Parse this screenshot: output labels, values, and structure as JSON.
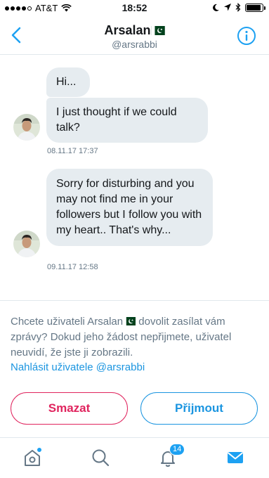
{
  "status_bar": {
    "carrier": "AT&T",
    "time": "18:52",
    "battery_level": 0.9
  },
  "header": {
    "name": "Arsalan",
    "handle": "@arsrabbi",
    "back_icon": "chevron-left-icon",
    "info_icon": "info-icon"
  },
  "messages": [
    {
      "text": "Hi...",
      "timestamp": ""
    },
    {
      "text": "I just thought if we could talk?",
      "timestamp": "08.11.17 17:37"
    },
    {
      "text": "Sorry for disturbing and you may not find me in your followers but I follow you with my heart.. That's why...",
      "timestamp": "09.11.17 12:58"
    }
  ],
  "request": {
    "text_prefix": "Chcete uživateli Arsalan",
    "text_suffix": " dovolit zasílat vám zprávy? Dokud jeho žádost nepřijmete, uživatel neuvidí, že jste ji zobrazili.",
    "report_link": "Nahlásit uživatele @arsrabbi",
    "delete_label": "Smazat",
    "accept_label": "Přijmout"
  },
  "tabs": {
    "home_icon": "home-icon",
    "search_icon": "search-icon",
    "notifications_icon": "bell-icon",
    "notifications_badge": "14",
    "messages_icon": "mail-icon"
  },
  "colors": {
    "accent": "#1da1f2",
    "danger": "#e0245e",
    "bubble": "#e6ecf0",
    "muted": "#657786"
  }
}
